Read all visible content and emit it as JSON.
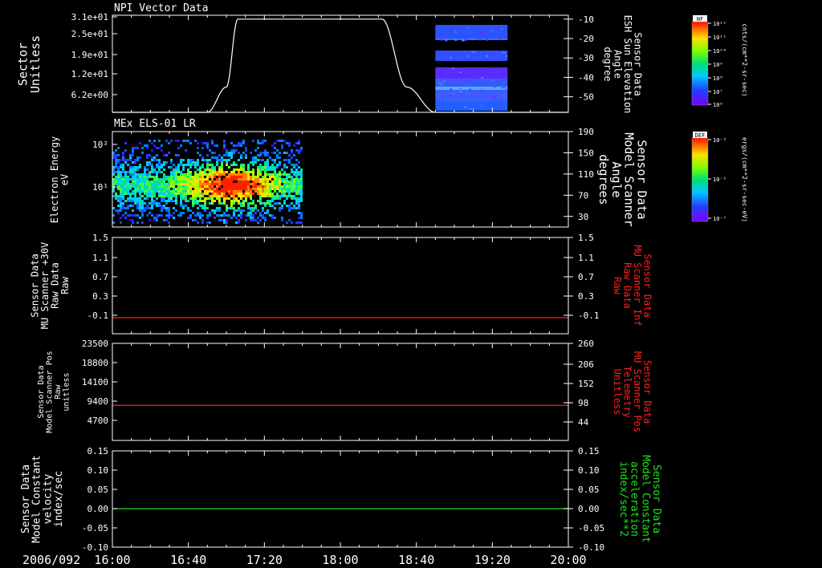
{
  "date_label": "2006/092",
  "time_ticks": [
    "16:00",
    "16:40",
    "17:20",
    "18:00",
    "18:40",
    "19:20",
    "20:00"
  ],
  "colorbars": [
    {
      "title": "NF",
      "units": "cnts/(cm**2-sr-sec)",
      "tick_labels": [
        "10¹²",
        "10¹¹",
        "10¹⁰",
        "10⁹",
        "10⁸",
        "10⁷",
        "10⁶"
      ]
    },
    {
      "title": "DEF",
      "units": "ergs/(cm**2-sr-sec-eV)",
      "tick_labels": [
        "10⁻³",
        "10⁻⁵",
        "10⁻⁷"
      ]
    }
  ],
  "chart_data": [
    {
      "type": "heatmap",
      "title": "NPI Vector Data",
      "ylabel": [
        "Sector",
        "Unitless"
      ],
      "yticks": [
        "3.1e+01",
        "2.5e+01",
        "1.9e+01",
        "1.2e+01",
        "6.2e+00"
      ],
      "right_axis": {
        "label": [
          "Sensor Data",
          "ESH Sun Elevation",
          "Angle",
          "degree"
        ],
        "ticks": [
          "-10",
          "-20",
          "-30",
          "-40",
          "-50"
        ],
        "ylim": [
          -58,
          -8
        ],
        "line_x": [
          "16:00",
          "16:50",
          "17:00",
          "17:06",
          "18:22",
          "18:35",
          "18:50",
          "20:00"
        ],
        "line_y": [
          -60,
          -60,
          -45,
          -10,
          -10,
          -45,
          -60,
          -60
        ]
      },
      "xlim": [
        "16:00",
        "20:00"
      ],
      "data_block_x": [
        "18:50",
        "19:28"
      ]
    },
    {
      "type": "heatmap",
      "title": "MEx ELS-01 LR",
      "ylabel": [
        "Electron Energy",
        "eV"
      ],
      "yticks": [
        "10²",
        "10¹"
      ],
      "right_axis": {
        "label": [
          "Sensor Data",
          "Model Scanner",
          "Angle",
          "degrees"
        ],
        "ticks": [
          "190",
          "150",
          "110",
          "70",
          "30"
        ],
        "ylim": [
          10,
          190
        ]
      },
      "xlim": [
        "16:00",
        "20:00"
      ],
      "data_block_x": [
        "16:00",
        "17:40"
      ]
    },
    {
      "type": "line",
      "ylabel": [
        "Sensor Data",
        "MU Scanner +30V",
        "Raw Data",
        "Raw"
      ],
      "yticks": [
        "1.5",
        "1.1",
        "0.7",
        "0.3",
        "-0.1"
      ],
      "ylim": [
        -0.3,
        1.5
      ],
      "right_axis": {
        "label": [
          "Sensor Data",
          "MU Scanner Inf",
          "Raw Data",
          "Raw"
        ],
        "ticks": [
          "1.5",
          "1.1",
          "0.7",
          "0.3",
          "-0.1"
        ],
        "color": "#ff2020"
      },
      "series": [
        {
          "x": [
            "16:00",
            "20:00"
          ],
          "y": [
            0.0,
            0.0
          ],
          "color": "#ff2020"
        }
      ]
    },
    {
      "type": "line",
      "ylabel": [
        "Sensor Data",
        "Model Scanner Pos",
        "Raw",
        "unitless"
      ],
      "yticks": [
        "23500",
        "18800",
        "14100",
        "9400",
        "4700"
      ],
      "ylim": [
        0,
        23500
      ],
      "right_axis": {
        "label": [
          "Sensor Data",
          "MU Scanner Pos",
          "Telemetry",
          "Unitless"
        ],
        "ticks": [
          "260",
          "206",
          "152",
          "98",
          "44"
        ],
        "color": "#ff2020"
      },
      "series": [
        {
          "x": [
            "16:00",
            "20:00"
          ],
          "y": [
            8500,
            8500
          ],
          "color": "#ff2020"
        }
      ]
    },
    {
      "type": "line",
      "ylabel": [
        "Sensor Data",
        "Model Constant",
        "velocity",
        "index/sec"
      ],
      "yticks": [
        "0.15",
        "0.10",
        "0.05",
        "0.00",
        "-0.05",
        "-0.10"
      ],
      "ylim": [
        -0.1,
        0.15
      ],
      "right_axis": {
        "label": [
          "Sensor Data",
          "Model Constant",
          "acceleration",
          "index/sec**2"
        ],
        "ticks": [
          "0.15",
          "0.10",
          "0.05",
          "0.00",
          "-0.05",
          "-0.10"
        ],
        "color": "#20e020"
      },
      "series": [
        {
          "x": [
            "16:00",
            "20:00"
          ],
          "y": [
            0.0,
            0.0
          ],
          "color": "#20e020"
        }
      ]
    }
  ]
}
